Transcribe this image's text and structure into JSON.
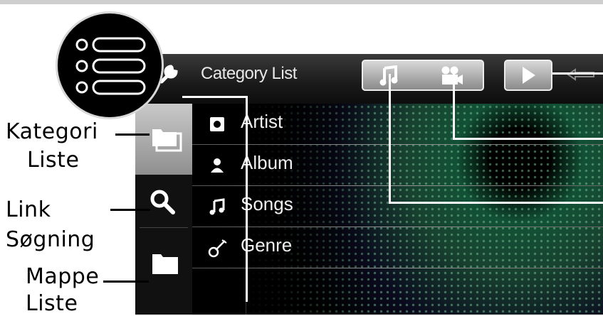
{
  "header": {
    "title": "Category List"
  },
  "sidebar": {
    "items": [
      {
        "name": "category-list",
        "icon": "folder-stack-icon",
        "selected": true
      },
      {
        "name": "search",
        "icon": "search-icon",
        "selected": false
      },
      {
        "name": "folder-list",
        "icon": "folder-icon",
        "selected": false
      }
    ]
  },
  "categories": [
    {
      "label": "Artist",
      "icon": "artist-icon"
    },
    {
      "label": "Album",
      "icon": "album-person-icon"
    },
    {
      "label": "Songs",
      "icon": "music-note-icon"
    },
    {
      "label": "Genre",
      "icon": "guitar-icon"
    }
  ],
  "callouts": {
    "kategori_line1": "Kategori",
    "kategori_line2": "Liste",
    "link_line1": "Link",
    "link_line2": "Søgning",
    "mappe_line1": "Mappe",
    "mappe_line2": "Liste"
  },
  "colors": {
    "selected_tab": "#b0b0b0",
    "text": "#f0f0f0",
    "pattern": "#5fbf8a"
  }
}
